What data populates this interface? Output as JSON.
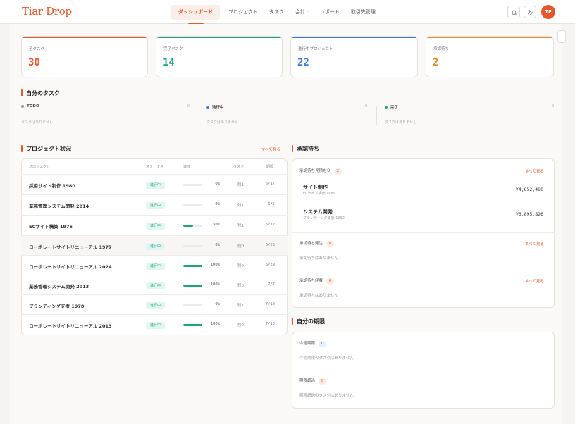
{
  "app": {
    "logo": "Tiar Drop"
  },
  "nav": [
    {
      "label": "ダッシュボード"
    },
    {
      "label": "プロジェクト"
    },
    {
      "label": "タスク"
    },
    {
      "label": "会計"
    },
    {
      "label": "レポート"
    },
    {
      "label": "取引先管理"
    }
  ],
  "nav_caret": "·",
  "user": {
    "initials": "TE"
  },
  "side_toggle": "‹",
  "stats": [
    {
      "label": "全タスク",
      "value": "30",
      "color": "#e8562c"
    },
    {
      "label": "完了タスク",
      "value": "14",
      "color": "#1aa57a"
    },
    {
      "label": "進行中プロジェクト",
      "value": "22",
      "color": "#3b7ddd"
    },
    {
      "label": "承認待ち",
      "value": "2",
      "color": "#f0892a"
    }
  ],
  "my_tasks": {
    "title": "自分のタスク",
    "columns": [
      {
        "label": "TODO",
        "count": "0",
        "empty": "タスクはありません",
        "color": "#8c93a8"
      },
      {
        "label": "進行中",
        "count": "0",
        "empty": "タスクはありません",
        "color": "#3b7ddd"
      },
      {
        "label": "完了",
        "count": "0",
        "empty": "タスクはありません",
        "color": "#1aa57a"
      }
    ]
  },
  "projects": {
    "title": "プロジェクト状況",
    "see_all": "すべて見る",
    "headers": {
      "name": "プロジェクト",
      "status": "ステータス",
      "progress": "進捗",
      "tasks": "タスク",
      "due": "期限"
    },
    "rows": [
      {
        "name": "採用サイト制作 1980",
        "status": "進行中",
        "progress": 0,
        "pct": "0%",
        "remaining": "残1",
        "due": "5/17"
      },
      {
        "name": "業務管理システム開発 2014",
        "status": "進行中",
        "progress": 0,
        "pct": "0%",
        "remaining": "残1",
        "due": "6/5"
      },
      {
        "name": "ECサイト構築 1975",
        "status": "進行中",
        "progress": 50,
        "pct": "50%",
        "remaining": "残1",
        "due": "6/12"
      },
      {
        "name": "コーポレートサイトリニューアル 1977",
        "status": "進行中",
        "progress": 0,
        "pct": "0%",
        "remaining": "残0",
        "due": "6/23"
      },
      {
        "name": "コーポレートサイトリニューアル 2024",
        "status": "進行中",
        "progress": 100,
        "pct": "100%",
        "remaining": "残0",
        "due": "6/29"
      },
      {
        "name": "業務管理システム開発 2013",
        "status": "進行中",
        "progress": 100,
        "pct": "100%",
        "remaining": "残0",
        "due": "7/7"
      },
      {
        "name": "ブランディング支援 1978",
        "status": "進行中",
        "progress": 0,
        "pct": "0%",
        "remaining": "残1",
        "due": "7/10"
      },
      {
        "name": "コーポレートサイトリニューアル 2013",
        "status": "進行中",
        "progress": 100,
        "pct": "100%",
        "remaining": "残0",
        "due": "7/15"
      }
    ]
  },
  "approvals": {
    "title": "承認待ち",
    "estimates": {
      "label": "承認待ち見積もり",
      "count": "2",
      "see_all": "すべて見る",
      "items": [
        {
          "title": "サイト制作",
          "sub": "ECサイト構築 1989",
          "amount": "¥4,852,480"
        },
        {
          "title": "システム開発",
          "sub": "ブランディング支援 1992",
          "amount": "¥6,895,826"
        }
      ]
    },
    "orders": {
      "label": "承認待ち発注",
      "count": "0",
      "see_all": "すべて見る",
      "empty": "承認待ちはありません"
    },
    "expenses": {
      "label": "承認待ち経費",
      "count": "0",
      "see_all": "すべて見る",
      "empty": "承認待ちはありません"
    }
  },
  "deadlines": {
    "title": "自分の期限",
    "this_week": {
      "label": "今週期限",
      "count": "0",
      "empty": "今週期限のタスクはありません"
    },
    "overdue": {
      "label": "期限超過",
      "count": "0",
      "empty": "期限超過のタスクはありません"
    }
  }
}
